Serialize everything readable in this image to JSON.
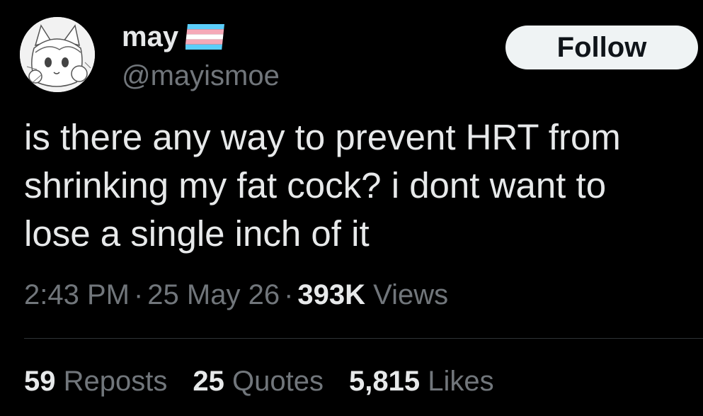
{
  "author": {
    "display_name": "may",
    "handle": "@mayismoe",
    "flag_icon": "transgender-flag-icon",
    "avatar_icon": "anime-catgirl-avatar"
  },
  "follow_label": "Follow",
  "tweet": {
    "lines": [
      "is there any way to prevent HRT from",
      "shrinking my fat cock? i dont want to",
      "lose a single inch of it"
    ]
  },
  "meta": {
    "time": "2:43 PM",
    "separator": "·",
    "date": "25 May 26",
    "views_count": "393K",
    "views_label": "Views"
  },
  "stats": {
    "reposts_count": "59",
    "reposts_label": "Reposts",
    "quotes_count": "25",
    "quotes_label": "Quotes",
    "likes_count": "5,815",
    "likes_label": "Likes"
  },
  "colors": {
    "background": "#000000",
    "primary_text": "#e7e9ea",
    "secondary_text": "#71767b",
    "button_bg": "#eff3f4",
    "divider": "#2f3336",
    "flag_blue": "#5bcefa",
    "flag_pink": "#f5a9b8",
    "flag_white": "#ffffff"
  }
}
